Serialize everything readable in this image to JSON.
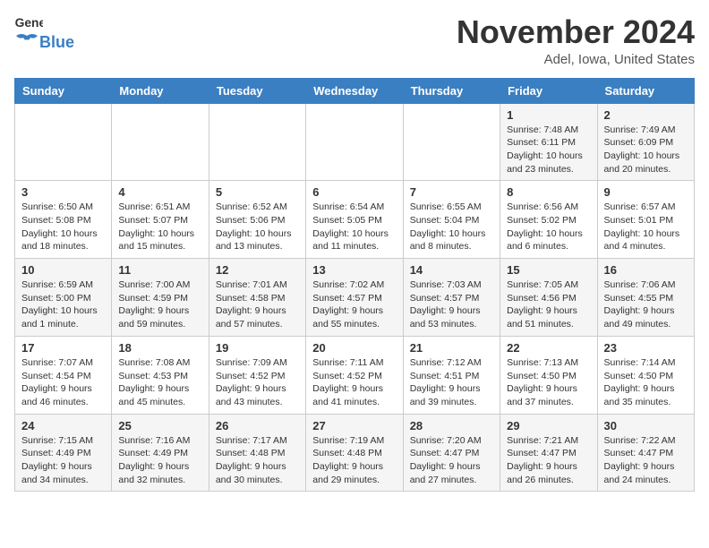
{
  "header": {
    "logo_general": "General",
    "logo_blue": "Blue",
    "month": "November 2024",
    "location": "Adel, Iowa, United States"
  },
  "weekdays": [
    "Sunday",
    "Monday",
    "Tuesday",
    "Wednesday",
    "Thursday",
    "Friday",
    "Saturday"
  ],
  "weeks": [
    [
      {
        "day": "",
        "info": ""
      },
      {
        "day": "",
        "info": ""
      },
      {
        "day": "",
        "info": ""
      },
      {
        "day": "",
        "info": ""
      },
      {
        "day": "",
        "info": ""
      },
      {
        "day": "1",
        "info": "Sunrise: 7:48 AM\nSunset: 6:11 PM\nDaylight: 10 hours\nand 23 minutes."
      },
      {
        "day": "2",
        "info": "Sunrise: 7:49 AM\nSunset: 6:09 PM\nDaylight: 10 hours\nand 20 minutes."
      }
    ],
    [
      {
        "day": "3",
        "info": "Sunrise: 6:50 AM\nSunset: 5:08 PM\nDaylight: 10 hours\nand 18 minutes."
      },
      {
        "day": "4",
        "info": "Sunrise: 6:51 AM\nSunset: 5:07 PM\nDaylight: 10 hours\nand 15 minutes."
      },
      {
        "day": "5",
        "info": "Sunrise: 6:52 AM\nSunset: 5:06 PM\nDaylight: 10 hours\nand 13 minutes."
      },
      {
        "day": "6",
        "info": "Sunrise: 6:54 AM\nSunset: 5:05 PM\nDaylight: 10 hours\nand 11 minutes."
      },
      {
        "day": "7",
        "info": "Sunrise: 6:55 AM\nSunset: 5:04 PM\nDaylight: 10 hours\nand 8 minutes."
      },
      {
        "day": "8",
        "info": "Sunrise: 6:56 AM\nSunset: 5:02 PM\nDaylight: 10 hours\nand 6 minutes."
      },
      {
        "day": "9",
        "info": "Sunrise: 6:57 AM\nSunset: 5:01 PM\nDaylight: 10 hours\nand 4 minutes."
      }
    ],
    [
      {
        "day": "10",
        "info": "Sunrise: 6:59 AM\nSunset: 5:00 PM\nDaylight: 10 hours\nand 1 minute."
      },
      {
        "day": "11",
        "info": "Sunrise: 7:00 AM\nSunset: 4:59 PM\nDaylight: 9 hours\nand 59 minutes."
      },
      {
        "day": "12",
        "info": "Sunrise: 7:01 AM\nSunset: 4:58 PM\nDaylight: 9 hours\nand 57 minutes."
      },
      {
        "day": "13",
        "info": "Sunrise: 7:02 AM\nSunset: 4:57 PM\nDaylight: 9 hours\nand 55 minutes."
      },
      {
        "day": "14",
        "info": "Sunrise: 7:03 AM\nSunset: 4:57 PM\nDaylight: 9 hours\nand 53 minutes."
      },
      {
        "day": "15",
        "info": "Sunrise: 7:05 AM\nSunset: 4:56 PM\nDaylight: 9 hours\nand 51 minutes."
      },
      {
        "day": "16",
        "info": "Sunrise: 7:06 AM\nSunset: 4:55 PM\nDaylight: 9 hours\nand 49 minutes."
      }
    ],
    [
      {
        "day": "17",
        "info": "Sunrise: 7:07 AM\nSunset: 4:54 PM\nDaylight: 9 hours\nand 46 minutes."
      },
      {
        "day": "18",
        "info": "Sunrise: 7:08 AM\nSunset: 4:53 PM\nDaylight: 9 hours\nand 45 minutes."
      },
      {
        "day": "19",
        "info": "Sunrise: 7:09 AM\nSunset: 4:52 PM\nDaylight: 9 hours\nand 43 minutes."
      },
      {
        "day": "20",
        "info": "Sunrise: 7:11 AM\nSunset: 4:52 PM\nDaylight: 9 hours\nand 41 minutes."
      },
      {
        "day": "21",
        "info": "Sunrise: 7:12 AM\nSunset: 4:51 PM\nDaylight: 9 hours\nand 39 minutes."
      },
      {
        "day": "22",
        "info": "Sunrise: 7:13 AM\nSunset: 4:50 PM\nDaylight: 9 hours\nand 37 minutes."
      },
      {
        "day": "23",
        "info": "Sunrise: 7:14 AM\nSunset: 4:50 PM\nDaylight: 9 hours\nand 35 minutes."
      }
    ],
    [
      {
        "day": "24",
        "info": "Sunrise: 7:15 AM\nSunset: 4:49 PM\nDaylight: 9 hours\nand 34 minutes."
      },
      {
        "day": "25",
        "info": "Sunrise: 7:16 AM\nSunset: 4:49 PM\nDaylight: 9 hours\nand 32 minutes."
      },
      {
        "day": "26",
        "info": "Sunrise: 7:17 AM\nSunset: 4:48 PM\nDaylight: 9 hours\nand 30 minutes."
      },
      {
        "day": "27",
        "info": "Sunrise: 7:19 AM\nSunset: 4:48 PM\nDaylight: 9 hours\nand 29 minutes."
      },
      {
        "day": "28",
        "info": "Sunrise: 7:20 AM\nSunset: 4:47 PM\nDaylight: 9 hours\nand 27 minutes."
      },
      {
        "day": "29",
        "info": "Sunrise: 7:21 AM\nSunset: 4:47 PM\nDaylight: 9 hours\nand 26 minutes."
      },
      {
        "day": "30",
        "info": "Sunrise: 7:22 AM\nSunset: 4:47 PM\nDaylight: 9 hours\nand 24 minutes."
      }
    ]
  ]
}
